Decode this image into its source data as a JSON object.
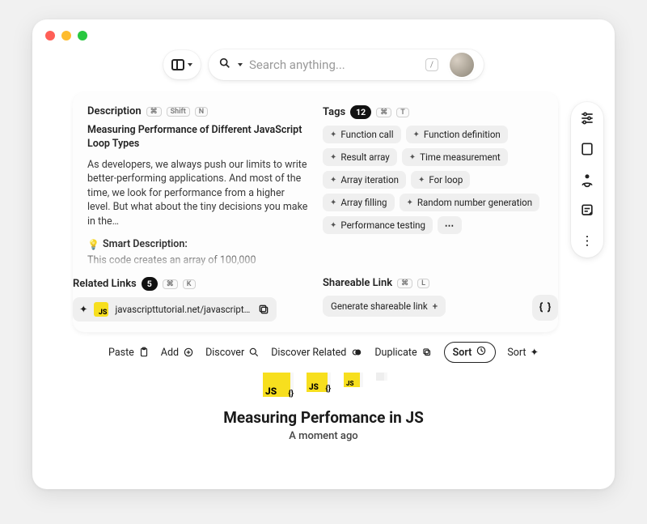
{
  "search": {
    "placeholder": "Search anything...",
    "shortcut": "/"
  },
  "description": {
    "label": "Description",
    "shortcuts": [
      "⌘",
      "Shift",
      "N"
    ],
    "title": "Measuring Performance of Different JavaScript Loop Types",
    "body": "As developers, we always push our limits to write better-performing applications. And most of the time, we look for performance from a higher level. But what about the tiny decisions you make in the…",
    "smart_label": "Smart Description:",
    "smart_body": "This code creates an array of 100,000"
  },
  "tags": {
    "label": "Tags",
    "count": "12",
    "shortcuts": [
      "⌘",
      "T"
    ],
    "items": [
      "Function call",
      "Function definition",
      "Result array",
      "Time measurement",
      "Array iteration",
      "For loop",
      "Array filling",
      "Random number generation",
      "Performance testing"
    ],
    "more": "⋯"
  },
  "related": {
    "label": "Related Links",
    "count": "5",
    "shortcuts": [
      "⌘",
      "K"
    ],
    "link_text": "javascripttutorial.net/javascript-arr"
  },
  "shareable": {
    "label": "Shareable Link",
    "shortcuts": [
      "⌘",
      "L"
    ],
    "generate": "Generate shareable link"
  },
  "actions": {
    "paste": "Paste",
    "add": "Add",
    "discover": "Discover",
    "discover_related": "Discover Related",
    "duplicate": "Duplicate",
    "sort1": "Sort",
    "sort2": "Sort"
  },
  "footer": {
    "title": "Measuring Perfomance in JS",
    "ago": "A moment ago"
  },
  "thumbs": {
    "js": "JS"
  }
}
